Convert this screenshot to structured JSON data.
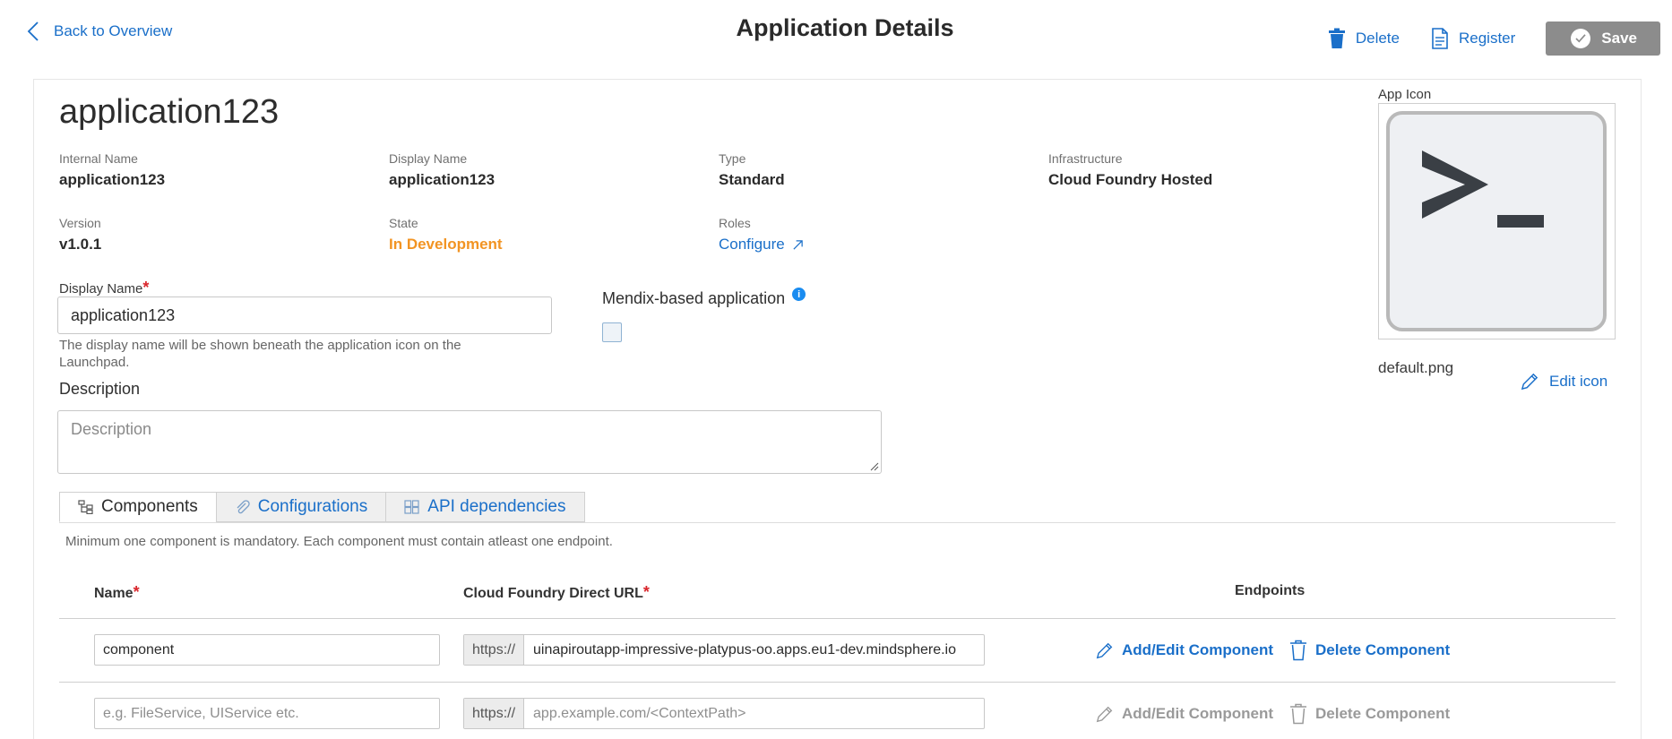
{
  "header": {
    "back_label": "Back to Overview",
    "title": "Application Details",
    "delete_label": "Delete",
    "register_label": "Register",
    "save_label": "Save"
  },
  "app": {
    "name": "application123",
    "fields": {
      "internal_name": {
        "label": "Internal Name",
        "value": "application123"
      },
      "display_name": {
        "label": "Display Name",
        "value": "application123"
      },
      "type": {
        "label": "Type",
        "value": "Standard"
      },
      "infrastructure": {
        "label": "Infrastructure",
        "value": "Cloud Foundry Hosted"
      },
      "version": {
        "label": "Version",
        "value": "v1.0.1"
      },
      "state": {
        "label": "State",
        "value": "In Development"
      },
      "roles": {
        "label": "Roles",
        "value": "Configure"
      }
    }
  },
  "form": {
    "display_name_label": "Display Name",
    "display_name_value": "application123",
    "display_name_help": "The display name will be shown beneath the application icon on the Launchpad.",
    "mendix_label": "Mendix-based application",
    "description_label": "Description",
    "description_placeholder": "Description"
  },
  "app_icon": {
    "label": "App Icon",
    "file_name": "default.png",
    "edit_label": "Edit icon",
    "glyph": ">_"
  },
  "tabs": [
    {
      "label": "Components",
      "icon": "tree-icon",
      "active": true
    },
    {
      "label": "Configurations",
      "icon": "paperclip-icon",
      "active": false
    },
    {
      "label": "API dependencies",
      "icon": "grid-icon",
      "active": false
    }
  ],
  "components": {
    "note": "Minimum one component is mandatory. Each component must contain atleast one endpoint.",
    "headers": {
      "name": "Name",
      "url": "Cloud Foundry Direct URL",
      "endpoints": "Endpoints"
    },
    "url_prefix": "https://",
    "rows": [
      {
        "name": "component",
        "url": "uinapiroutapp-impressive-platypus-oo.apps.eu1-dev.mindsphere.io",
        "add_edit_label": "Add/Edit Component",
        "delete_label": "Delete Component",
        "enabled": true
      },
      {
        "name_placeholder": "e.g. FileService, UIService etc.",
        "url_placeholder": "app.example.com/<ContextPath>",
        "add_edit_label": "Add/Edit Component",
        "delete_label": "Delete Component",
        "enabled": false
      }
    ]
  },
  "colors": {
    "link": "#1a6fc9",
    "state_orange": "#f29423",
    "required": "#d9262c",
    "save_bg": "#8c8c8c"
  }
}
